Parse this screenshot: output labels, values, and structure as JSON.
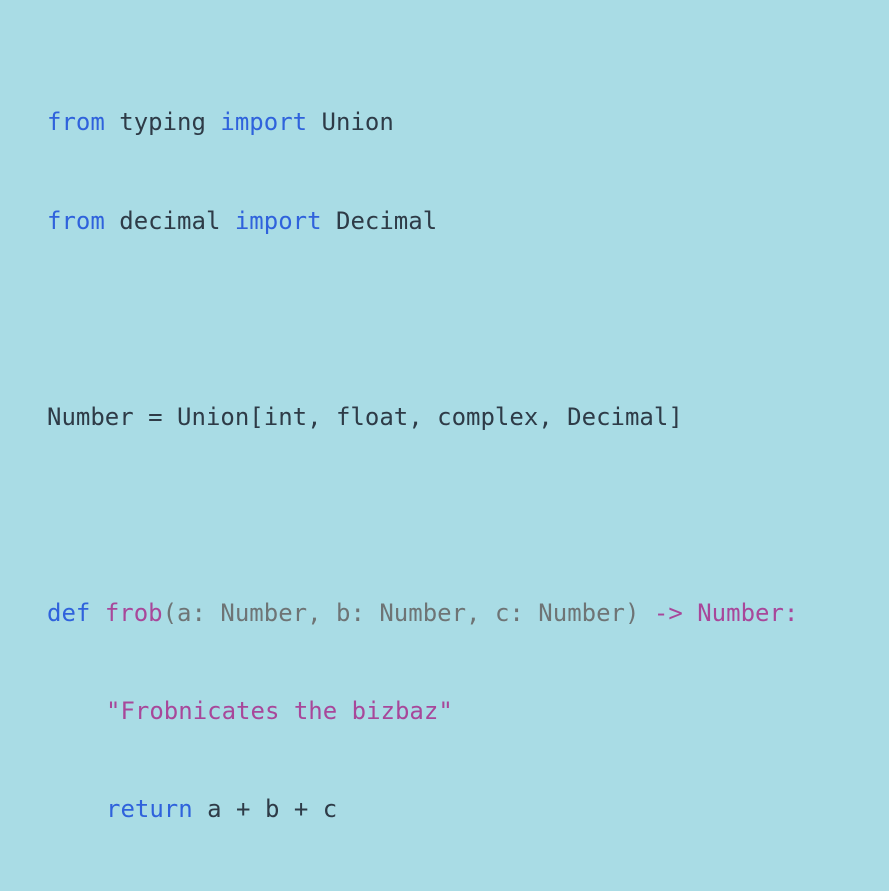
{
  "code": {
    "line1": {
      "kw_from": "from",
      "module": " typing ",
      "kw_import": "import",
      "name": " Union"
    },
    "line2": {
      "kw_from": "from",
      "module": " decimal ",
      "kw_import": "import",
      "name": " Decimal"
    },
    "line3": {
      "text": "Number = Union[int, float, complex, Decimal]"
    },
    "line4": {
      "kw_def": "def",
      "space": " ",
      "fn_name": "frob",
      "params": "(a: Number, b: Number, c: Number)",
      "arrow_return": " -> Number:"
    },
    "line5": {
      "docstring": "\"Frobnicates the bizbaz\""
    },
    "line6": {
      "kw_return": "return",
      "expr": " a + b + c"
    }
  },
  "colors": {
    "background": "#a9dce5",
    "keyword": "#2f62dc",
    "function_and_string": "#a8479a",
    "parameters": "#6e7475",
    "plain": "#2e3b47"
  }
}
